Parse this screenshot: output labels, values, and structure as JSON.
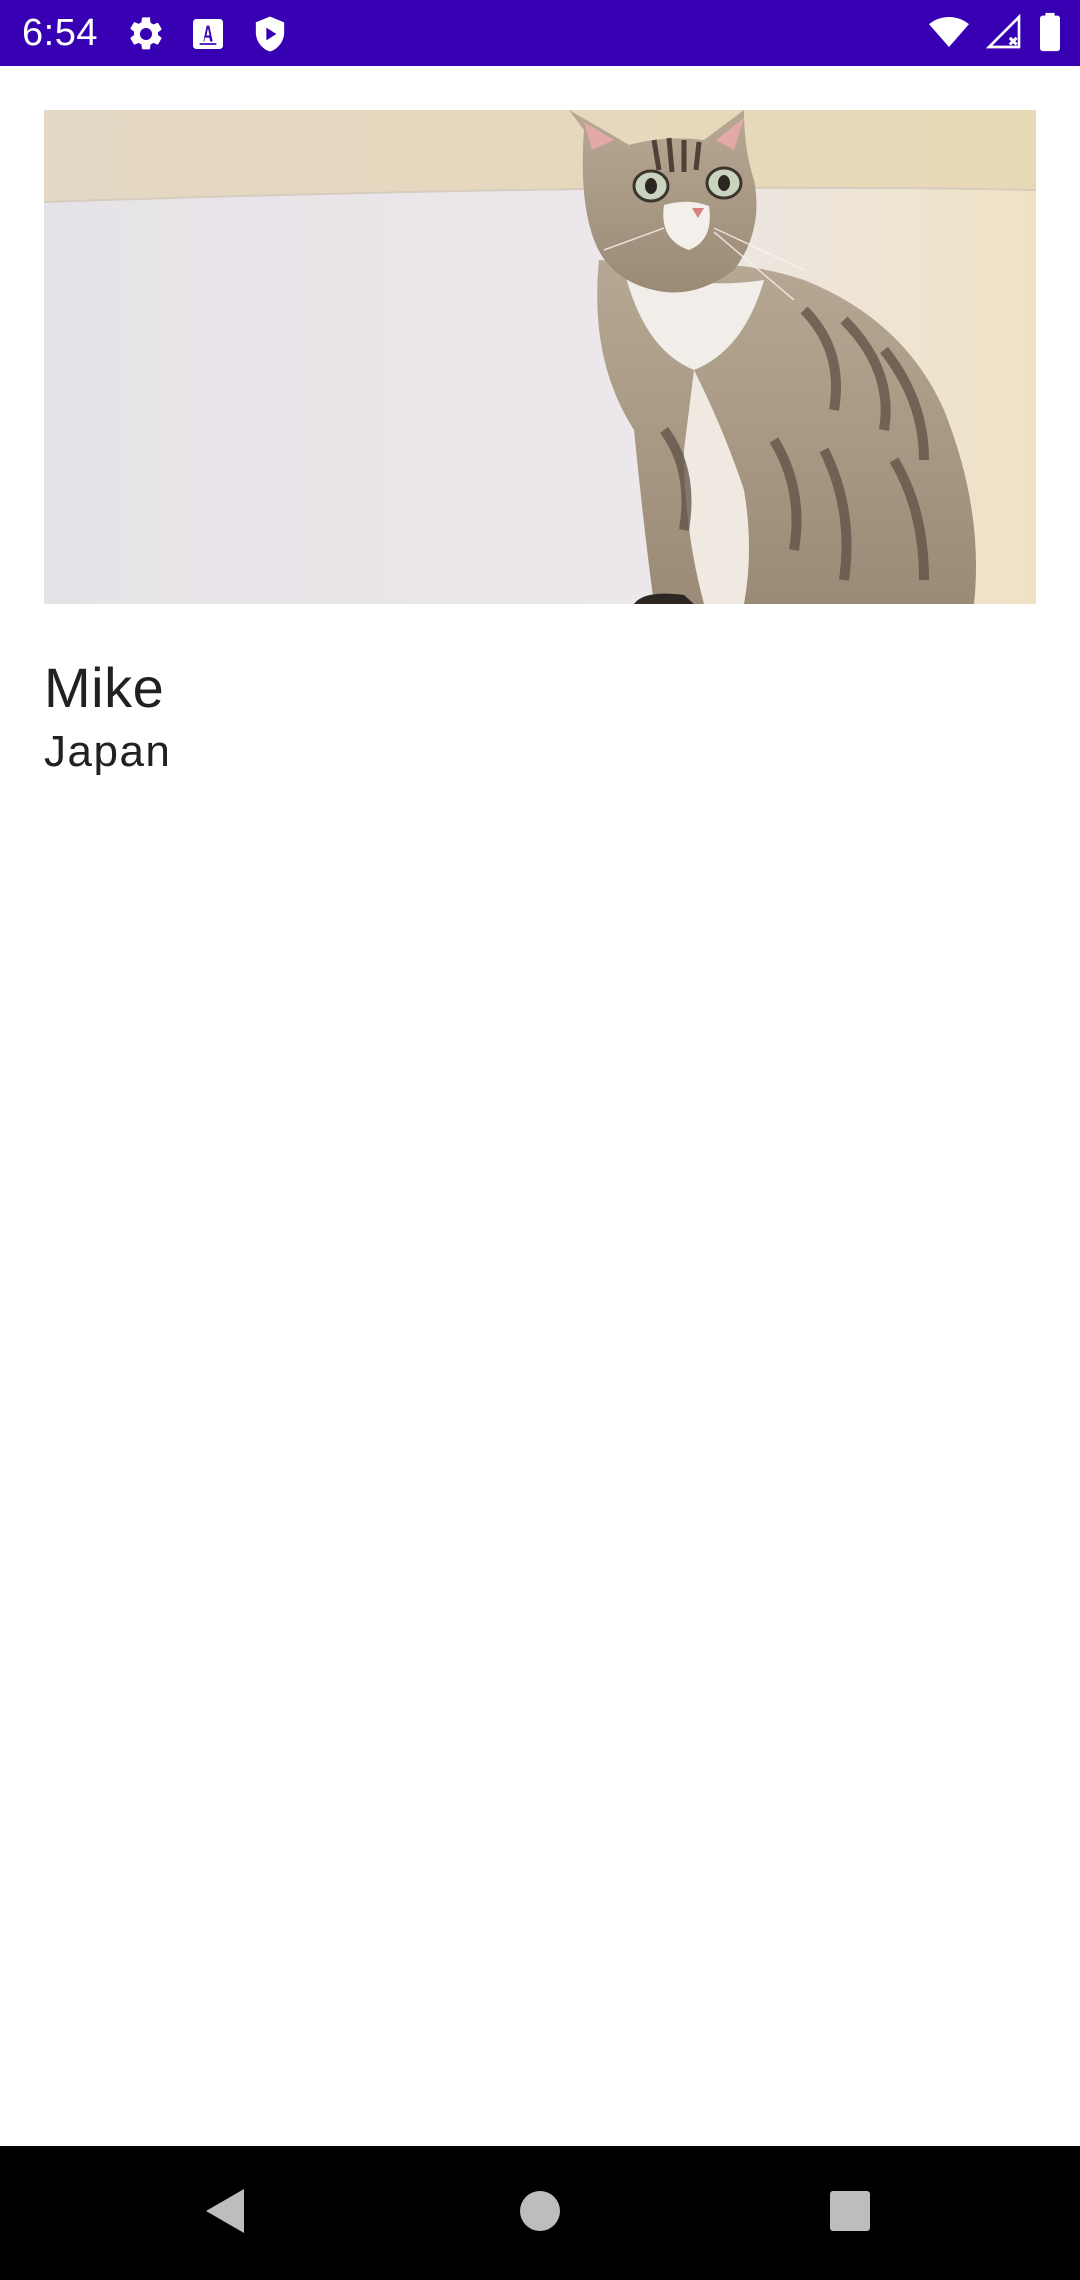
{
  "status_bar": {
    "time": "6:54",
    "background": "#3700b3",
    "left_icons": [
      "gear-icon",
      "text-a-icon",
      "shield-play-icon"
    ],
    "right_icons": [
      "wifi-icon",
      "signal-no-data-icon",
      "battery-icon"
    ]
  },
  "detail": {
    "photo": "cat-photo",
    "name": "Mike",
    "country": "Japan"
  },
  "nav_bar": {
    "buttons": [
      "back-icon",
      "home-icon",
      "recents-icon"
    ]
  }
}
